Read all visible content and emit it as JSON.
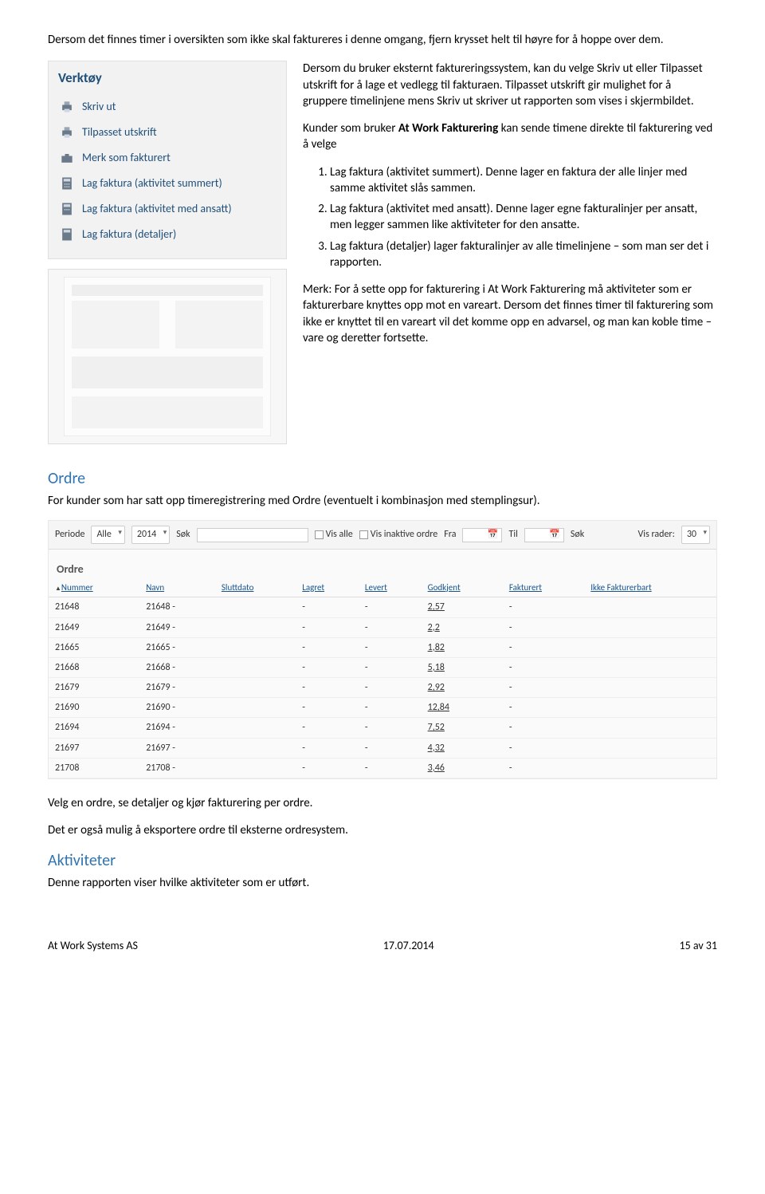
{
  "intro": "Dersom det finnes timer i oversikten som ikke skal faktureres i denne omgang, fjern krysset helt til høyre for å hoppe over dem.",
  "verktoy": {
    "title": "Verktøy",
    "items": [
      "Skriv ut",
      "Tilpasset utskrift",
      "Merk som fakturert",
      "Lag faktura (aktivitet summert)",
      "Lag faktura (aktivitet med ansatt)",
      "Lag faktura (detaljer)"
    ]
  },
  "right": {
    "p1a": "Dersom du bruker eksternt faktureringssystem, kan du velge Skriv ut eller Tilpasset utskrift for å lage et vedlegg til fakturaen. Tilpasset utskrift gir mulighet for å gruppere timelinjene mens Skriv ut skriver ut rapporten som vises i skjermbildet.",
    "p2_lead": "Kunder som bruker ",
    "p2_b": "At Work Fakturering",
    "p2_tail": " kan sende timene direkte til fakturering ved å velge",
    "ol": [
      "Lag faktura (aktivitet summert). Denne lager en faktura der alle linjer med samme aktivitet slås sammen.",
      "Lag faktura (aktivitet med ansatt). Denne lager egne fakturalinjer per ansatt, men legger sammen like aktiviteter for den ansatte.",
      "Lag faktura (detaljer) lager fakturalinjer av alle timelinjene – som man ser det i rapporten."
    ],
    "p3": "Merk: For å sette opp for fakturering i At Work Fakturering må aktiviteter som er fakturerbare knyttes opp mot en vareart. Dersom det finnes timer til fakturering som ikke er knyttet til en vareart vil det komme opp en advarsel, og man kan koble time – vare og deretter fortsette."
  },
  "ordre_section": {
    "heading": "Ordre",
    "intro": "For kunder som har satt opp timeregistrering med Ordre (eventuelt i kombinasjon med stemplingsur).",
    "filter": {
      "periode_label": "Periode",
      "periode_value": "Alle",
      "year_value": "2014",
      "sok_label": "Søk",
      "visalle": "Vis alle",
      "visinaktive": "Vis inaktive ordre",
      "fra": "Fra",
      "til": "Til",
      "sok2": "Søk",
      "visrader_label": "Vis rader:",
      "visrader_value": "30"
    },
    "table_title": "Ordre",
    "columns": [
      "Nummer",
      "Navn",
      "Sluttdato",
      "Lagret",
      "Levert",
      "Godkjent",
      "Fakturert",
      "Ikke Fakturerbart"
    ],
    "rows": [
      {
        "num": "21648",
        "navn": "21648 -",
        "godkjent": "2,57"
      },
      {
        "num": "21649",
        "navn": "21649 -",
        "godkjent": "2,2"
      },
      {
        "num": "21665",
        "navn": "21665 -",
        "godkjent": "1,82"
      },
      {
        "num": "21668",
        "navn": "21668 -",
        "godkjent": "5,18"
      },
      {
        "num": "21679",
        "navn": "21679 -",
        "godkjent": "2,92"
      },
      {
        "num": "21690",
        "navn": "21690 -",
        "godkjent": "12,84"
      },
      {
        "num": "21694",
        "navn": "21694 -",
        "godkjent": "7,52"
      },
      {
        "num": "21697",
        "navn": "21697 -",
        "godkjent": "4,32"
      },
      {
        "num": "21708",
        "navn": "21708 -",
        "godkjent": "3,46"
      }
    ],
    "after1": "Velg en ordre, se detaljer og kjør fakturering per ordre.",
    "after2": "Det er også mulig å eksportere ordre til eksterne ordresystem."
  },
  "aktiviteter": {
    "heading": "Aktiviteter",
    "body": "Denne rapporten viser hvilke aktiviteter som er utført."
  },
  "footer": {
    "left": "At Work Systems AS",
    "center": "17.07.2014",
    "right": "15 av 31"
  }
}
